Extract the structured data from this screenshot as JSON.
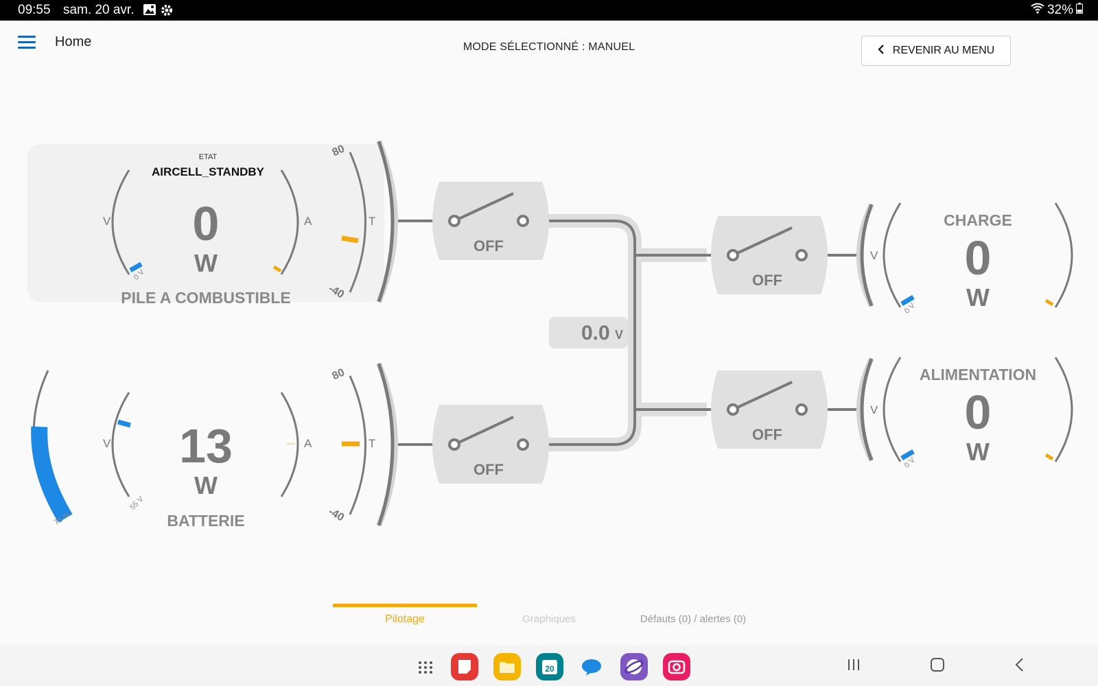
{
  "status_bar": {
    "time": "09:55",
    "date": "sam. 20 avr.",
    "battery": "32%"
  },
  "app_bar": {
    "title": "Home",
    "mode_label": "MODE SÉLECTIONNÉ : MANUEL",
    "back_button_label": "REVENIR AU MENU"
  },
  "fuel_cell": {
    "state_caption": "ETAT",
    "state_value": "AIRCELL_STANDBY",
    "power_value": "0",
    "power_unit": "W",
    "name": "PILE A COMBUSTIBLE",
    "v_label": "V",
    "a_label": "A",
    "t_label": "T",
    "voltage_reading": "0 V",
    "temp_max": "80",
    "temp_min": "-40",
    "switch_state": "OFF"
  },
  "battery": {
    "power_value": "13",
    "power_unit": "W",
    "name": "BATTERIE",
    "v_label": "V",
    "a_label": "A",
    "t_label": "T",
    "voltage_reading": "55 V",
    "soc_reading": "75 %",
    "soc_fraction": 0.75,
    "temp_max": "80",
    "temp_min": "-40",
    "switch_state": "OFF"
  },
  "bus": {
    "voltage_value": "0.0",
    "voltage_unit": "V"
  },
  "load": {
    "name": "CHARGE",
    "power_value": "0",
    "power_unit": "W",
    "v_label": "V",
    "voltage_reading": "0 V",
    "switch_state": "OFF"
  },
  "supply": {
    "name": "ALIMENTATION",
    "power_value": "0",
    "power_unit": "W",
    "v_label": "V",
    "voltage_reading": "0 V",
    "switch_state": "OFF"
  },
  "tabs": [
    {
      "label": "Pilotage",
      "active": true
    },
    {
      "label": "Graphiques",
      "active": false
    },
    {
      "label": "Défauts (0) / alertes (0)",
      "active": false
    }
  ],
  "colors": {
    "accent": "#f3a90d",
    "gauge_blue": "#1e88e5",
    "line_gray": "#7a7a7a",
    "pipe_light": "#dedede"
  },
  "dock_icons": [
    "apps-grid-icon",
    "notes-app-icon",
    "files-app-icon",
    "calendar-app-icon",
    "messages-app-icon",
    "browser-app-icon",
    "camera-app-icon"
  ],
  "calendar_day": "20"
}
